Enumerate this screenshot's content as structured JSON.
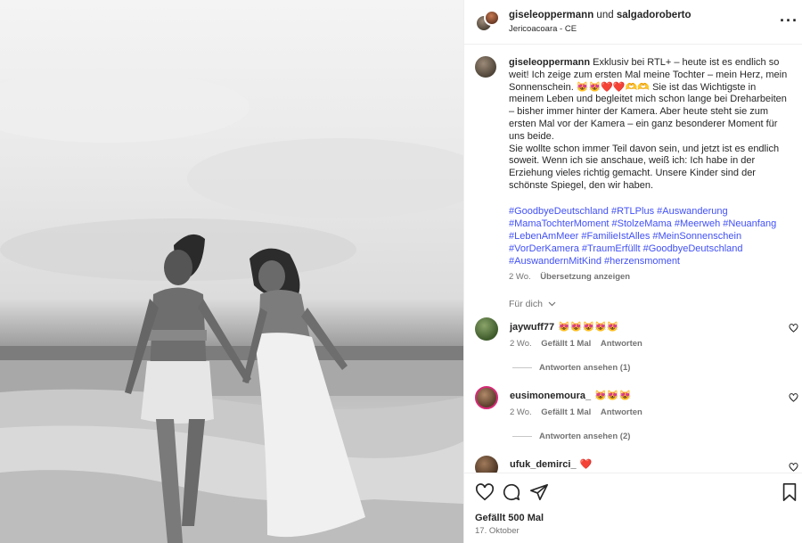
{
  "post": {
    "photo_alt": "photo",
    "author": "giseleoppermann",
    "joiner": "und",
    "coauthor": "salgadoroberto",
    "location": "Jericoacoara - CE",
    "more_icon": "more-horizontal-icon"
  },
  "caption": {
    "username": "giseleoppermann",
    "text": " Exklusiv bei RTL+ – heute ist es endlich so weit! Ich zeige zum ersten Mal meine Tochter – mein Herz, mein Sonnenschein. 😻😻❤️❤️🫶🫶 Sie ist das Wichtigste in meinem Leben und begleitet mich schon lange bei Dreharbeiten – bisher immer hinter der Kamera. Aber heute steht sie zum ersten Mal vor der Kamera – ein ganz besonderer Moment für uns beide.\nSie wollte schon immer Teil davon sein, und jetzt ist es endlich soweit. Wenn ich sie anschaue, weiß ich: Ich habe in der Erziehung vieles richtig gemacht. Unsere Kinder sind der schönste Spiegel, den wir haben.",
    "hashtags": "#GoodbyeDeutschland #RTLPlus #Auswanderung #MamaTochterMoment #StolzeMama #Meerweh #Neuanfang #LebenAmMeer #FamilieIstAlles #MeinSonnenschein #VorDerKamera #TraumErfüllt #GoodbyeDeutschland #AuswandernMitKind #herzensmoment",
    "age": "2 Wo.",
    "translate": "Übersetzung anzeigen"
  },
  "for_you": "Für dich",
  "comments": [
    {
      "username": "jaywuff77",
      "text": "😻😻😻😻😻",
      "age": "2 Wo.",
      "likes": "Gefällt 1 Mal",
      "reply": "Antworten",
      "view_replies": "Antworten ansehen (1)"
    },
    {
      "username": "eusimonemoura_",
      "text": "😻😻😻",
      "age": "2 Wo.",
      "likes": "Gefällt 1 Mal",
      "reply": "Antworten",
      "view_replies": "Antworten ansehen (2)"
    },
    {
      "username": "ufuk_demirci_",
      "text": "❤️"
    }
  ],
  "footer": {
    "likes": "Gefällt 500 Mal",
    "date": "17. Oktober"
  },
  "colors": {
    "link": "#4150f7",
    "muted": "#737373",
    "text": "#262626"
  }
}
